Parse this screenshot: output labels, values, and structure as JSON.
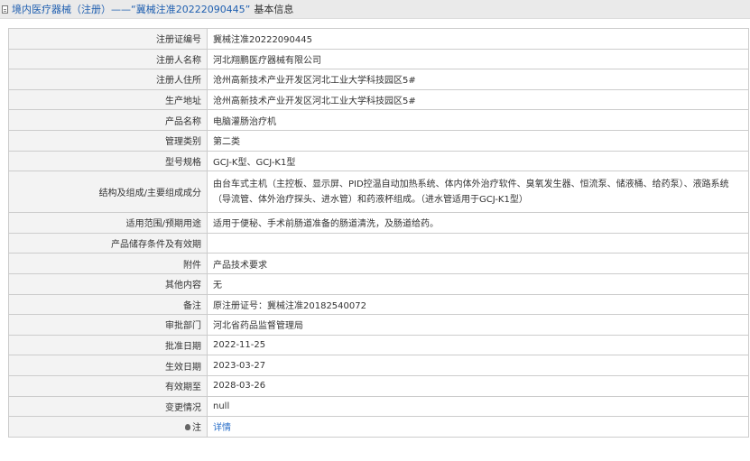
{
  "header": {
    "prefix": "境内医疗器械（注册）",
    "dash": "——",
    "reg_no_quoted": "“冀械注准20222090445”",
    "suffix": "基本信息"
  },
  "rows": [
    {
      "label": "注册证编号",
      "value": "冀械注准20222090445"
    },
    {
      "label": "注册人名称",
      "value": "河北翔鹏医疗器械有限公司"
    },
    {
      "label": "注册人住所",
      "value": "沧州高新技术产业开发区河北工业大学科技园区5#"
    },
    {
      "label": "生产地址",
      "value": "沧州高新技术产业开发区河北工业大学科技园区5#"
    },
    {
      "label": "产品名称",
      "value": "电脑灌肠治疗机"
    },
    {
      "label": "管理类别",
      "value": "第二类"
    },
    {
      "label": "型号规格",
      "value": "GCJ-K型、GCJ-K1型"
    },
    {
      "label": "结构及组成/主要组成成分",
      "value": "由台车式主机（主控板、显示屏、PID控温自动加热系统、体内体外治疗软件、臭氧发生器、恒流泵、储液桶、给药泵）、液路系统（导流管、体外治疗探头、进水管）和药液杯组成。（进水管适用于GCJ-K1型）"
    },
    {
      "label": "适用范围/预期用途",
      "value": "适用于便秘、手术前肠道准备的肠道清洗，及肠道给药。"
    },
    {
      "label": "产品储存条件及有效期",
      "value": ""
    },
    {
      "label": "附件",
      "value": "产品技术要求"
    },
    {
      "label": "其他内容",
      "value": "无"
    },
    {
      "label": "备注",
      "value": "原注册证号：冀械注准20182540072"
    },
    {
      "label": "审批部门",
      "value": "河北省药品监督管理局"
    },
    {
      "label": "批准日期",
      "value": "2022-11-25"
    },
    {
      "label": "生效日期",
      "value": "2023-03-27"
    },
    {
      "label": "有效期至",
      "value": "2028-03-26"
    },
    {
      "label": "变更情况",
      "value": "null"
    },
    {
      "label": "注",
      "value": "详情"
    }
  ],
  "colors": {
    "title_blue": "#1f5fb0",
    "link_blue": "#2a6fc9",
    "label_bg": "#f3f3f3"
  },
  "icons": {
    "header": "document-icon",
    "note": "lightbulb-icon"
  }
}
